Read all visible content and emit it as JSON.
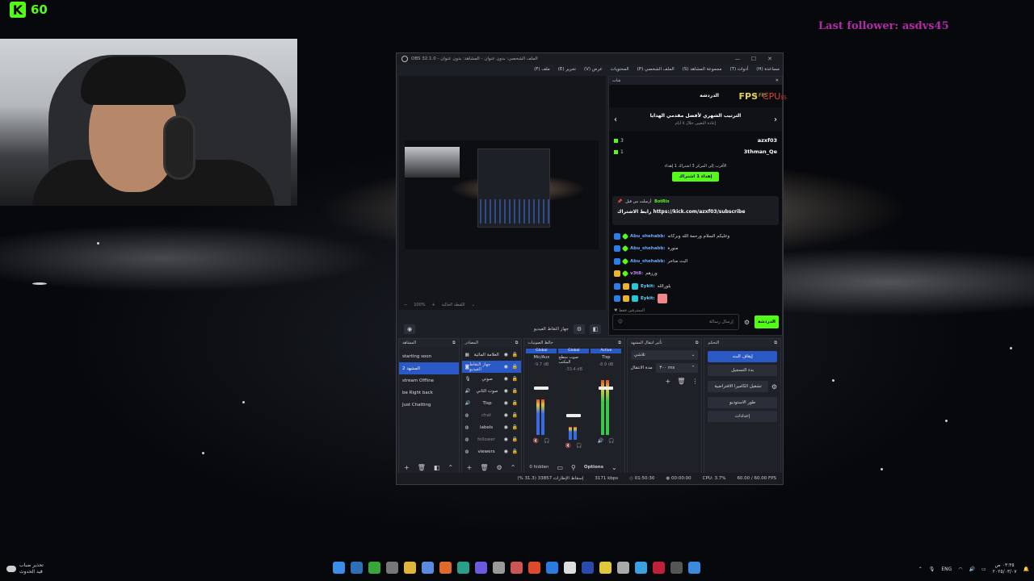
{
  "overlay": {
    "kick_count": "60",
    "last_follower": "Last follower: asdvs45"
  },
  "obs": {
    "title": "OBS 32.1.0 - الملف الشخصي: بدون عنوان - المشاهد: بدون عنوان",
    "menu": [
      "ملف (F)",
      "تحرير (E)",
      "عرض (V)",
      "المحتويات",
      "الملف الشخصي (P)",
      "مجموعة المشاهد (S)",
      "أدوات (T)",
      "مساعدة (H)"
    ],
    "preview_zoom": "100%",
    "preview_label": "اللقطة الحالية",
    "preview_source_label": "جهاز التقاط الفيديو",
    "chat": {
      "dock_title": "شات",
      "leaderboard_title": "الدردشة",
      "fps_tag": "FPS",
      "fps_value": "4 FPS",
      "cpu_tag": "CPU",
      "cpu_value": "55",
      "lb_main": "الترتيب الشهري لأفضل مقدمي الهدايا",
      "lb_sub": "إعادة التعيين خلال ٥ أيام",
      "ranks": [
        {
          "name": "azxf03",
          "count": "3"
        },
        {
          "name": "3thman_Qe",
          "count": "1"
        }
      ],
      "gift_line": "الأقرب إلى المركز 3 اشتراك 1 إهداء",
      "gift_button": "إهداء 1 اشتراك",
      "pin_by": "أرسلت من قبل",
      "pin_user": "BotRix",
      "pin_msg": "رابط الاشتراك https://kick.com/azxf03/subscribe",
      "messages": [
        {
          "user": "Abu_shehabb:",
          "text": "وعليكم السلام ورحمة الله وبركاته"
        },
        {
          "user": "Abu_shehabb:",
          "text": "منورة"
        },
        {
          "user": "Abu_shehabb:",
          "text": "البث متاخر"
        },
        {
          "user": "v3t8:",
          "text": "ورزهم"
        },
        {
          "user": "Eykit:",
          "text": "بلورالله"
        },
        {
          "user": "Eykit:",
          "text": ""
        }
      ],
      "moderators": "المشرفين فقط",
      "input_placeholder": "إرسال رسالة",
      "send_label": "الدردشة"
    },
    "scenes": {
      "title": "المشاهد",
      "items": [
        "starting soon",
        "المشهد 2",
        "stream Offline",
        "be Right back",
        "Just Chatting"
      ],
      "selected": 1
    },
    "sources": {
      "title": "المصادر",
      "items": [
        "العلامة المائية",
        "جهاز التقاط الفيديو",
        "صوتي",
        "صوت الثاني",
        "Tisp",
        "chat",
        "labels",
        "follower",
        "viewers"
      ]
    },
    "mixer": {
      "title": "خالط الصوتيات",
      "channels": [
        {
          "hdr": "Global",
          "name": "Mic/Aux",
          "db": "-9.7 dB",
          "level": 0.55,
          "fader": 0.7,
          "muted": true
        },
        {
          "hdr": "Global",
          "name": "صوت سطح المكتب",
          "db": "-33.4 dB",
          "level": 0.2,
          "fader": 0.35,
          "muted": true
        },
        {
          "hdr": "Active",
          "name": "Tisp",
          "db": "-8.9 dB",
          "level": 0.85,
          "fader": 0.7,
          "muted": false
        }
      ],
      "hidden": "0 hidden",
      "options": "Options"
    },
    "transitions": {
      "title": "تأثير انتقال المشهد",
      "type": "تلاشي",
      "duration_label": "مدة الانتقال",
      "duration": "٣٠٠ ms"
    },
    "controls": {
      "title": "التحكم",
      "buttons": [
        "إيقاف البث",
        "بدء التسجيل",
        "تشغيل الكاميرا الافتراضية",
        "طور الاستوديو",
        "إعدادات"
      ]
    },
    "status": {
      "dropped": "إسقاط الإطارات 33857 (31.3 %)",
      "bitrate": "3171 kbps",
      "live": "01:50:30",
      "rec": "00:00:00",
      "cpu": "CPU: 3.7%",
      "fps": "60.00 / 60.00 FPS"
    }
  },
  "taskbar": {
    "weather_line1": "تحذير ضباب",
    "weather_line2": "قيد الحدوث",
    "lang": "ENG",
    "time": "٠٣:٣٥ ص",
    "date": "٢٠٢٥/٠٣/٠٧"
  }
}
